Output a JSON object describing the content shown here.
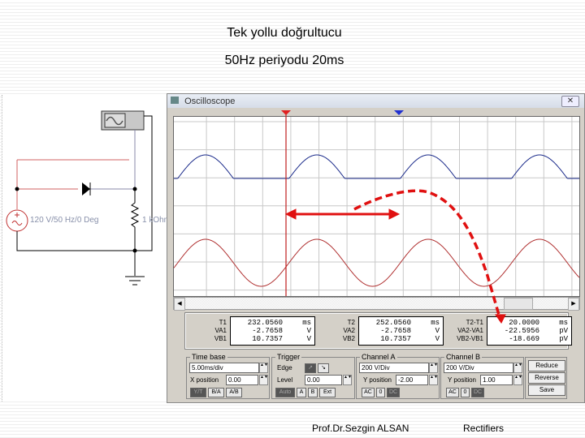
{
  "slide": {
    "title": "Tek yollu doğrultucu",
    "subtitle": "50Hz periyodu 20ms",
    "author": "Prof.Dr.Sezgin ALSAN",
    "topic": "Rectifiers"
  },
  "circuit": {
    "source_label": "120 V/50 Hz/0 Deg",
    "resistor_label": "1 kOhm"
  },
  "oscilloscope": {
    "window_title": "Oscilloscope",
    "cursor1": "1",
    "cursor2": "2",
    "readouts": {
      "cursor1": {
        "labels": [
          "T1",
          "VA1",
          "VB1"
        ],
        "values": [
          "232.0560",
          "-2.7658",
          "10.7357"
        ],
        "units": [
          "ms",
          "V",
          "V"
        ]
      },
      "cursor2": {
        "labels": [
          "T2",
          "VA2",
          "VB2"
        ],
        "values": [
          "252.0560",
          "-2.7658",
          "10.7357"
        ],
        "units": [
          "ms",
          "V",
          "V"
        ]
      },
      "diff": {
        "labels": [
          "T2-T1",
          "VA2-VA1",
          "VB2-VB1"
        ],
        "values": [
          "20.0000",
          "-22.5956",
          "-18.669"
        ],
        "units": [
          "ms",
          "pV",
          "pV"
        ]
      }
    },
    "timebase": {
      "label": "Time base",
      "scale": "5.00ms/div",
      "xpos_label": "X position",
      "xpos": "0.00",
      "modes": [
        "Y/T",
        "B/A",
        "A/B"
      ],
      "active_mode": "Y/T"
    },
    "trigger": {
      "label": "Trigger",
      "edge_label": "Edge",
      "level_label": "Level",
      "level": "0.00",
      "modes": [
        "Auto",
        "A",
        "B",
        "Ext"
      ],
      "active": "Auto"
    },
    "channel_a": {
      "label": "Channel A",
      "scale": "200 V/Div",
      "ypos_label": "Y position",
      "ypos": "-2.00",
      "coupling": [
        "AC",
        "0",
        "DC"
      ],
      "active": "DC",
      "color": "#b03030"
    },
    "channel_b": {
      "label": "Channel B",
      "scale": "200 V/Div",
      "ypos_label": "Y position",
      "ypos": "1.00",
      "coupling": [
        "AC",
        "0",
        "DC"
      ],
      "active": "DC",
      "color": "#1a2a8a"
    },
    "buttons": [
      "Reduce",
      "Reverse",
      "Save"
    ]
  },
  "annotation_color": "#e01010"
}
